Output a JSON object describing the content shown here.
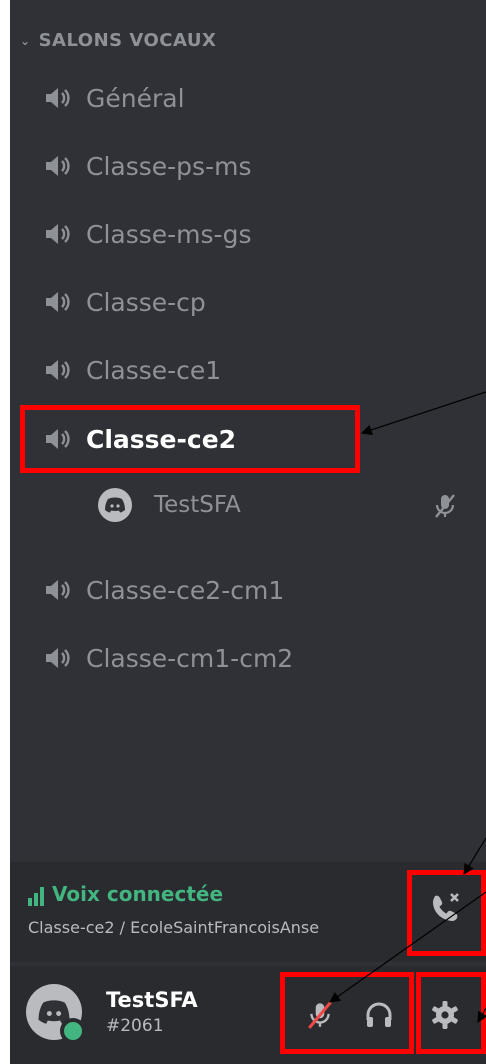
{
  "category": {
    "label": "SALONS VOCAUX"
  },
  "channels": [
    {
      "label": "Général"
    },
    {
      "label": "Classe-ps-ms"
    },
    {
      "label": "Classe-ms-gs"
    },
    {
      "label": "Classe-cp"
    },
    {
      "label": "Classe-ce1"
    },
    {
      "label": "Classe-ce2",
      "active": true
    },
    {
      "label": "Classe-ce2-cm1"
    },
    {
      "label": "Classe-cm1-cm2"
    }
  ],
  "voice_users": [
    {
      "name": "TestSFA",
      "muted": true
    }
  ],
  "voice_status": {
    "label": "Voix connectée",
    "location": "Classe-ce2 / EcoleSaintFrancoisAnse"
  },
  "user": {
    "name": "TestSFA",
    "tag": "#2061",
    "status": "online"
  },
  "icons": {
    "channel": "speaker-icon",
    "mute": "microphone-muted-icon",
    "deafen": "headphones-icon",
    "settings": "gear-icon",
    "disconnect": "phone-disconnect-icon"
  },
  "colors": {
    "background": "#2f3136",
    "panel_dark": "#292b2f",
    "text_muted": "#8e9297",
    "text_active": "#ffffff",
    "connected": "#43b581",
    "mute_red": "#f04747",
    "annotation": "#ff0000"
  }
}
